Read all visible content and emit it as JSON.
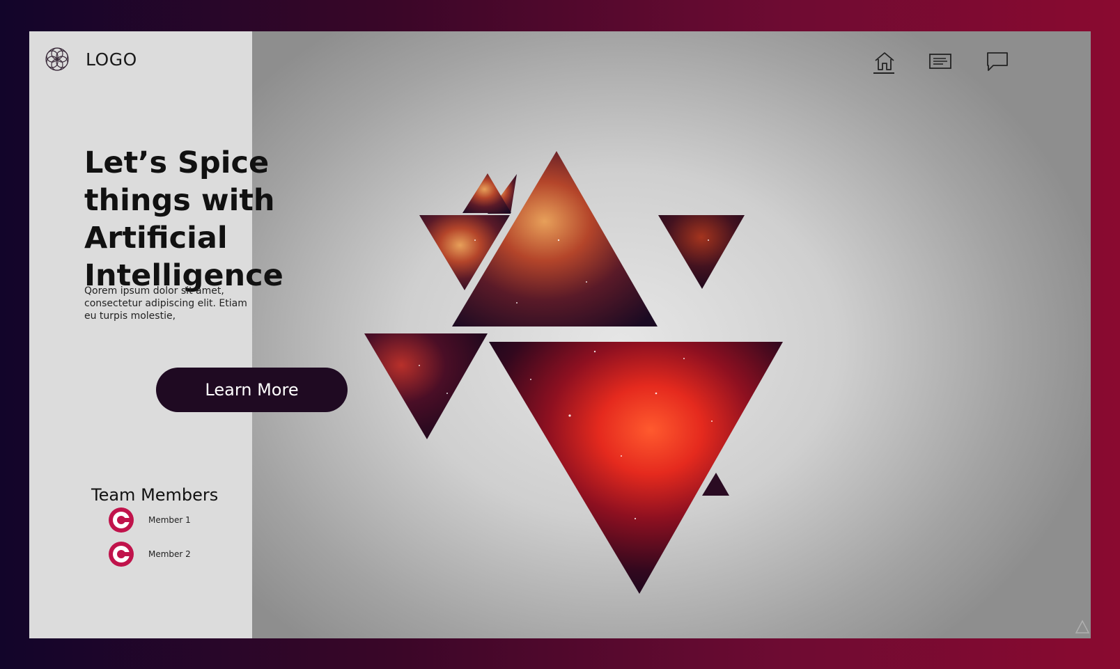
{
  "brand": {
    "logo_text": "LOGO",
    "logo_icon": "flower-of-life-icon"
  },
  "nav": {
    "items": [
      {
        "icon": "home-icon",
        "active": true
      },
      {
        "icon": "article-icon",
        "active": false
      },
      {
        "icon": "chat-bubble-icon",
        "active": false
      }
    ]
  },
  "hero": {
    "headline": "Let’s Spice things with Artificial Intelligence",
    "description": "Qorem ipsum dolor sit amet, consectetur adipiscing elit. Etiam eu turpis molestie,",
    "cta_label": "Learn More"
  },
  "team": {
    "title": "Team Members",
    "members": [
      {
        "name": "Member 1",
        "avatar_icon": "avatar-icon"
      },
      {
        "name": "Member 2",
        "avatar_icon": "avatar-icon"
      }
    ]
  },
  "colors": {
    "frame_gradient_start": "#12052a",
    "frame_gradient_end": "#8a0a30",
    "panel_bg": "#dcdcdc",
    "cta_bg": "#1f0a22",
    "avatar_accent": "#c0134b",
    "nebula_core": "#ff3b2a"
  },
  "artwork": {
    "description_icon": "nebula-triangles-illustration"
  }
}
